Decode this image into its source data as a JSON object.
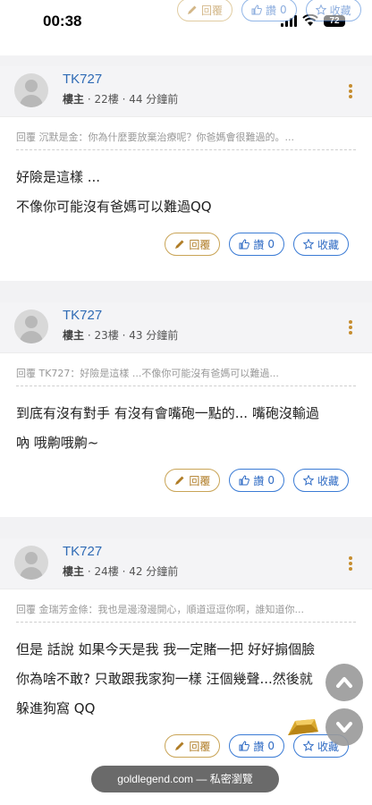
{
  "status_bar": {
    "time": "00:38",
    "battery": "72"
  },
  "actions": {
    "reply": "回覆",
    "like_prefix": "讚",
    "favorite": "收藏"
  },
  "posts": [
    {
      "username": "TK727",
      "role": "樓主",
      "floor": "22樓",
      "time_ago": "44 分鐘前",
      "quote": "回覆 沉默是金：你為什麼要放棄治療呢？你爸媽會很難過的。...",
      "content": [
        "好險是這樣 ...",
        "不像你可能沒有爸媽可以難過QQ"
      ],
      "likes": "0"
    },
    {
      "username": "TK727",
      "role": "樓主",
      "floor": "23樓",
      "time_ago": "43 分鐘前",
      "quote": "回覆 TK727：好險是這樣 ...不像你可能沒有爸媽可以難過...",
      "content": [
        "到底有沒有對手 有沒有會嘴砲一點的... 嘴砲沒輸過",
        "吶 哦齁哦齁~"
      ],
      "likes": "0"
    },
    {
      "username": "TK727",
      "role": "樓主",
      "floor": "24樓",
      "time_ago": "42 分鐘前",
      "quote": "回覆 金瑞芳金條：我也是邊潑邊開心，順道逗逗你啊，誰知道你...",
      "content": [
        "但是 話說 如果今天是我 我一定賭一把 好好搧個臉",
        "你為啥不敢? 只敢跟我家狗一樣 汪個幾聲...然後就",
        "躲進狗窩 QQ"
      ],
      "likes": "0"
    }
  ],
  "browser": {
    "url_label": "goldlegend.com — 私密瀏覽"
  },
  "colors": {
    "link_blue": "#2f6bb5",
    "reply_gold": "#b07d27",
    "header_bg": "#f4f4f6"
  },
  "icons": [
    "pencil-icon",
    "thumbs-up-icon",
    "star-icon",
    "kebab-menu-icon",
    "chevron-up-icon",
    "chevron-down-icon",
    "gold-bar-icon"
  ]
}
